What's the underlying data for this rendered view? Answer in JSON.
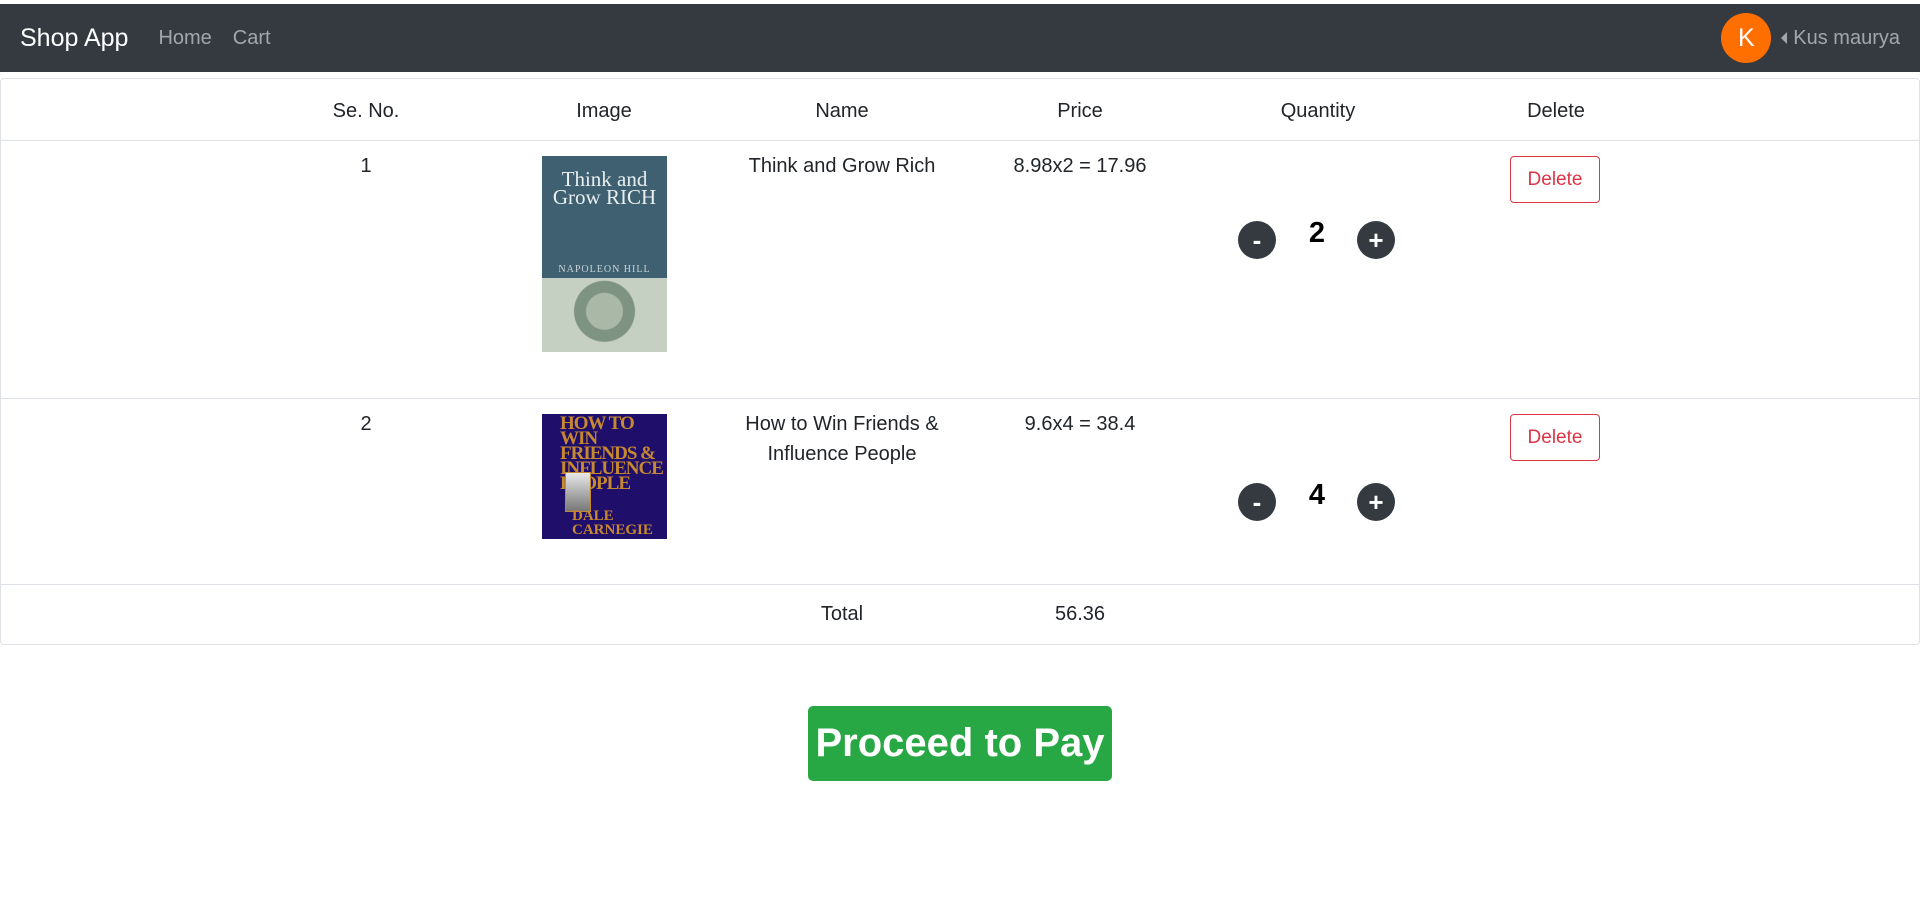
{
  "navbar": {
    "brand": "Shop App",
    "links": [
      "Home",
      "Cart"
    ],
    "avatar_letter": "K",
    "username": "Kus maurya",
    "avatar_color": "#ff6f00",
    "bg_color": "#343a40"
  },
  "cart": {
    "headers": [
      "Se. No.",
      "Image",
      "Name",
      "Price",
      "Quantity",
      "Delete"
    ],
    "items": [
      {
        "serial": "1",
        "name": "Think and Grow Rich",
        "price": "8.98x2 = 17.96",
        "quantity": "2",
        "delete_label": "Delete",
        "cover_title": "Think and Grow RICH",
        "cover_author": "NAPOLEON HILL"
      },
      {
        "serial": "2",
        "name": "How to Win Friends & Influence People",
        "price": "9.6x4 = 38.4",
        "quantity": "4",
        "delete_label": "Delete",
        "cover_title": "HOW TO WIN FRIENDS & INFLUENCE PEOPLE",
        "cover_author": "DALE CARNEGIE"
      }
    ],
    "total_label": "Total",
    "total_value": "56.36",
    "minus_symbol": "-",
    "plus_symbol": "+"
  },
  "checkout": {
    "pay_label": "Proceed to Pay",
    "pay_color": "#28a745"
  }
}
